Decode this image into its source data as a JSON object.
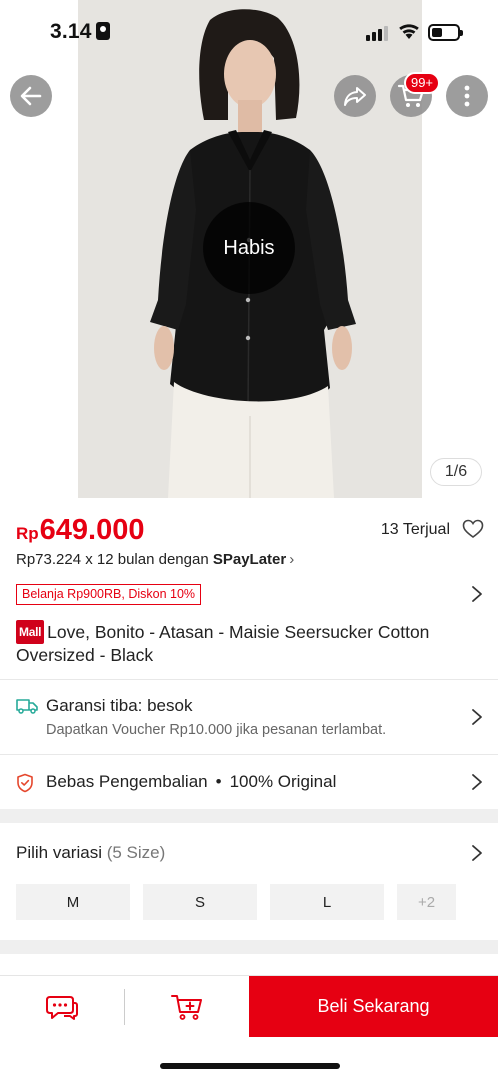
{
  "status_bar": {
    "time": "3.14"
  },
  "hero": {
    "stock_overlay": "Habis",
    "page_indicator": "1/6",
    "cart_badge": "99+"
  },
  "price": {
    "currency": "Rp",
    "value": "649.000",
    "sold": "13 Terjual",
    "installment_prefix": "Rp73.224 x 12 bulan dengan ",
    "installment_brand": "SPayLater",
    "promo_tag": "Belanja Rp900RB, Diskon 10%"
  },
  "product": {
    "mall_badge": "Mall",
    "title": "Love, Bonito - Atasan - Maisie Seersucker Cotton Oversized - Black"
  },
  "shipping": {
    "title": "Garansi tiba: besok",
    "subtitle": "Dapatkan Voucher Rp10.000 jika pesanan terlambat."
  },
  "returns": {
    "free_return": "Bebas Pengembalian",
    "separator": "•",
    "original": "100% Original"
  },
  "variants": {
    "title": "Pilih variasi",
    "count": "(5 Size)",
    "options": [
      "M",
      "S",
      "L",
      "+2"
    ]
  },
  "bottom_bar": {
    "buy_label": "Beli Sekarang"
  },
  "colors": {
    "accent": "#e60012",
    "brand_mall": "#d0011b",
    "shipping_icon": "#26aa99"
  }
}
